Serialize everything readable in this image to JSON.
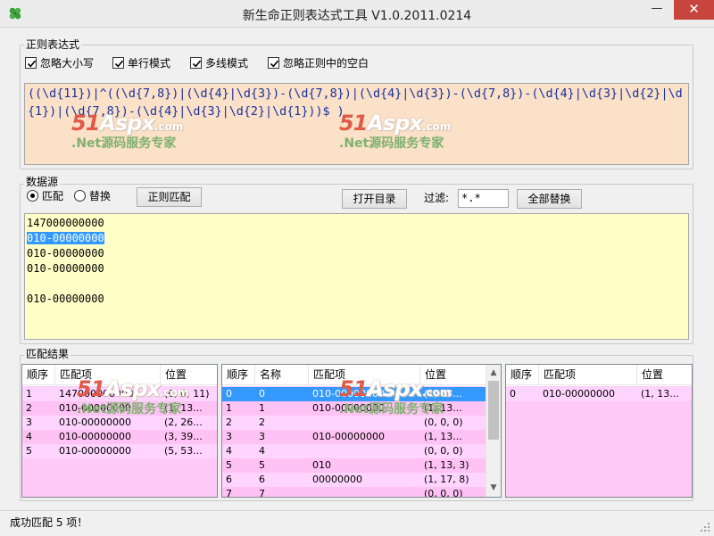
{
  "window": {
    "title": "新生命正则表达式工具 V1.0.2011.0214",
    "minimize_icon": "minimize-icon",
    "maximize_icon": "maximize-icon",
    "close_icon": "close-icon",
    "close_color": "#c7453c"
  },
  "regex_group": {
    "label": "正则表达式",
    "options": [
      {
        "label": "忽略大小写",
        "checked": true
      },
      {
        "label": "单行模式",
        "checked": true
      },
      {
        "label": "多线模式",
        "checked": true
      },
      {
        "label": "忽略正则中的空白",
        "checked": true
      }
    ],
    "pattern": "((\\d{11})|^((\\d{7,8})|(\\d{4}|\\d{3})-(\\d{7,8})|(\\d{4}|\\d{3})-(\\d{7,8})-(\\d{4}|\\d{3}|\\d{2}|\\d{1})|(\\d{7,8})-(\\d{4}|\\d{3}|\\d{2}|\\d{1}))$ )",
    "background": "#fbe1c7"
  },
  "source_group": {
    "label": "数据源",
    "mode_match": "匹配",
    "mode_replace": "替换",
    "selected_mode": "match",
    "regex_match_button": "正则匹配",
    "open_dir_button": "打开目录",
    "filter_label": "过滤:",
    "filter_value": "*.*",
    "replace_all_button": "全部替换",
    "lines": [
      "147000000000",
      "010-00000000",
      "010-00000000",
      "010-00000000",
      "",
      "010-00000000"
    ],
    "selected_line": 1,
    "background": "#ffffc8"
  },
  "results_group": {
    "label": "匹配结果",
    "matches": {
      "columns": [
        "顺序",
        "匹配项",
        "位置"
      ],
      "rows": [
        [
          "1",
          "147000000000",
          "(0, 0, 11)"
        ],
        [
          "2",
          "010-00000000",
          "(1, 13..."
        ],
        [
          "3",
          "010-00000000",
          "(2, 26..."
        ],
        [
          "4",
          "010-00000000",
          "(3, 39..."
        ],
        [
          "5",
          "010-00000000",
          "(5, 53..."
        ]
      ]
    },
    "groups": {
      "columns": [
        "顺序",
        "名称",
        "匹配项",
        "位置"
      ],
      "rows": [
        [
          "0",
          "0",
          "010-00000000",
          "(1, 13..."
        ],
        [
          "1",
          "1",
          "010-00000000",
          "(1, 13..."
        ],
        [
          "2",
          "2",
          "",
          "(0, 0, 0)"
        ],
        [
          "3",
          "3",
          "010-00000000",
          "(1, 13..."
        ],
        [
          "4",
          "4",
          "",
          "(0, 0, 0)"
        ],
        [
          "5",
          "5",
          "010",
          "(1, 13, 3)"
        ],
        [
          "6",
          "6",
          "00000000",
          "(1, 17, 8)"
        ],
        [
          "7",
          "7",
          "",
          "(0, 0, 0)"
        ]
      ],
      "selected_row": 0
    },
    "captures": {
      "columns": [
        "顺序",
        "匹配项",
        "位置"
      ],
      "rows": [
        [
          "0",
          "010-00000000",
          "(1, 13..."
        ]
      ]
    },
    "row_colors": {
      "odd": "#ffd4ff",
      "even": "#ffc2f4",
      "selected": "#3399ff"
    }
  },
  "watermark": {
    "brand_red": "51",
    "brand_rest": "Aspx",
    "brand_tld": ".com",
    "tagline": ".Net源码服务专家"
  },
  "status": {
    "text": "成功匹配 5 项！"
  }
}
